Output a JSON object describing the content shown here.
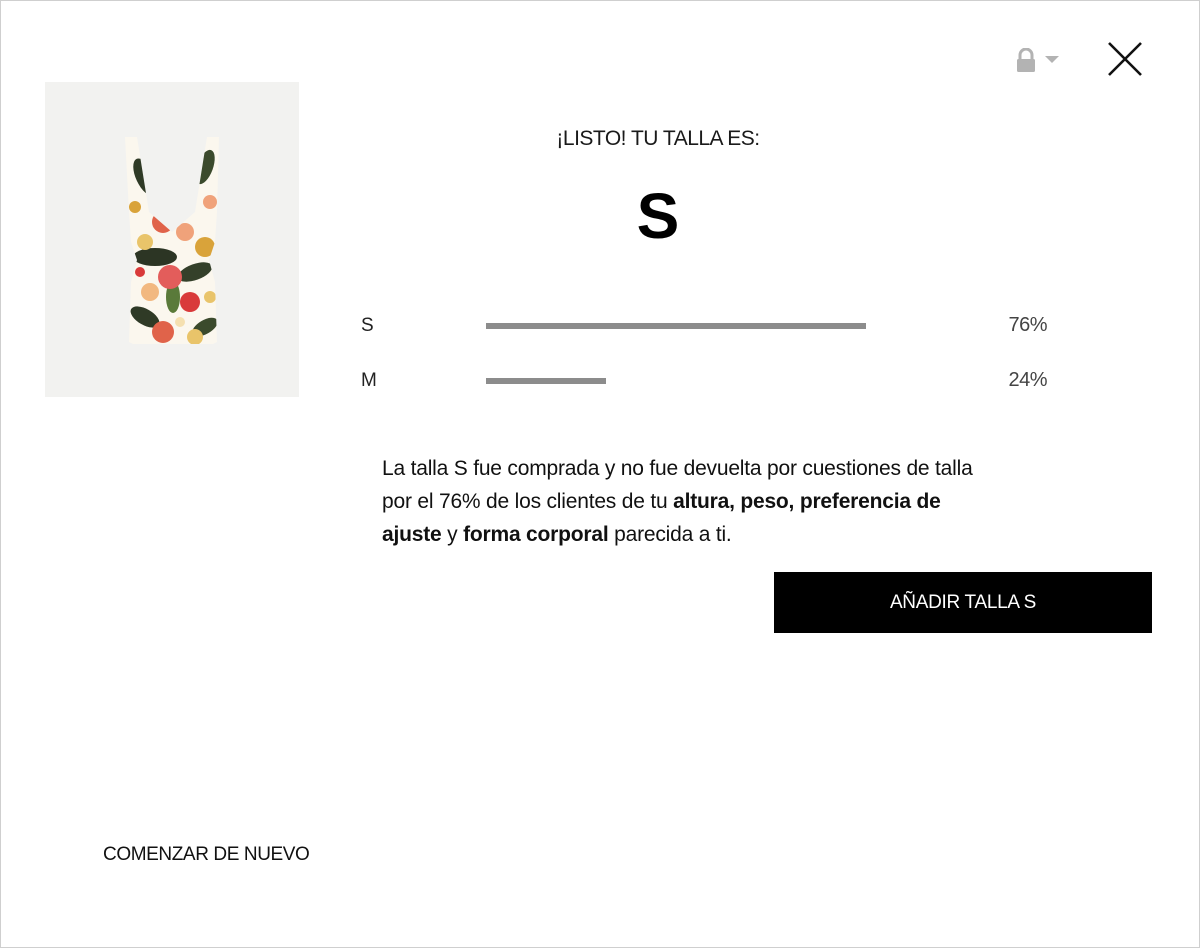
{
  "header": {
    "lock_icon": "lock-icon",
    "caret_icon": "chevron-down-icon",
    "close_icon": "close-icon"
  },
  "product": {
    "image_icon": "floral-dress-image"
  },
  "result": {
    "heading": "¡LISTO! TU TALLA ES:",
    "size": "S"
  },
  "distribution": [
    {
      "label": "S",
      "percent_text": "76%",
      "share": 0.76
    },
    {
      "label": "M",
      "percent_text": "24%",
      "share": 0.24
    }
  ],
  "explanation": {
    "part1": "La talla S fue comprada y no fue devuelta por cuestiones de talla por el 76% de los clientes de tu ",
    "bold1": "altura, peso, preferencia de ajuste",
    "part2": " y ",
    "bold2": "forma corporal",
    "part3": " parecida a ti."
  },
  "actions": {
    "add_label": "AÑADIR TALLA S",
    "restart_label": "COMENZAR DE NUEVO"
  },
  "colors": {
    "bar": "#8c8c8c",
    "button_bg": "#000000",
    "button_text": "#ffffff",
    "image_bg": "#f2f2f0"
  }
}
